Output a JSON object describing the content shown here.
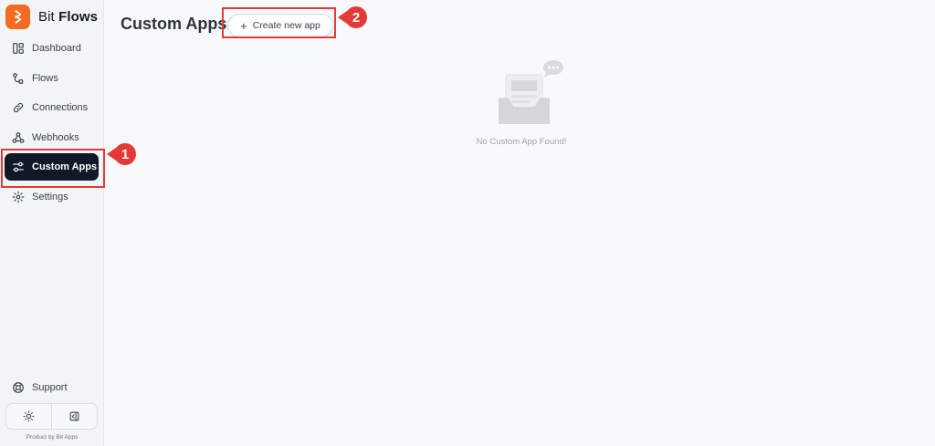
{
  "brand": {
    "name_regular": "Bit",
    "name_bold": "Flows",
    "accent": "#f36b21"
  },
  "sidebar": {
    "items": [
      {
        "label": "Dashboard",
        "icon": "dashboard-icon"
      },
      {
        "label": "Flows",
        "icon": "flows-icon"
      },
      {
        "label": "Connections",
        "icon": "link-icon"
      },
      {
        "label": "Webhooks",
        "icon": "webhook-icon"
      },
      {
        "label": "Custom Apps",
        "icon": "sliders-icon",
        "active": true
      },
      {
        "label": "Settings",
        "icon": "gear-icon"
      }
    ],
    "support_label": "Support",
    "theme_toggle_icon": "sun-icon",
    "collapse_icon": "sidebar-collapse-icon",
    "footer": "Product by Bit Apps"
  },
  "main": {
    "title": "Custom Apps",
    "create_button_label": "Create new app",
    "empty_message": "No Custom App Found!"
  },
  "annotations": [
    {
      "number": "1",
      "color": "#e53935"
    },
    {
      "number": "2",
      "color": "#e53935"
    }
  ]
}
